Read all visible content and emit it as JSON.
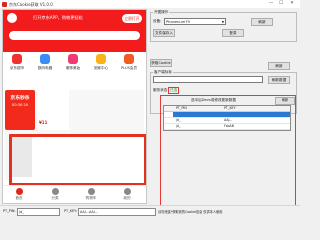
{
  "window": {
    "title": "京东Cookie获取 V1.0.0",
    "minimize": "—",
    "maximize": "☐",
    "close": "✕"
  },
  "phone": {
    "banner_text": "打开京东APP，购物更轻松",
    "open_button": "立即打开",
    "icons": [
      {
        "label": "京东超市",
        "color": "#f23030"
      },
      {
        "label": "数码电器",
        "color": "#3b8cf7"
      },
      {
        "label": "服饰美妆",
        "color": "#f23a72"
      },
      {
        "label": "到家中心",
        "color": "#f7b319"
      },
      {
        "label": "PLUS会员",
        "color": "#f25a22"
      }
    ],
    "promo": {
      "line1": "京东秒杀",
      "line2": "00:30:20"
    },
    "promo_price": "¥11",
    "nav": [
      {
        "label": "首页"
      },
      {
        "label": "分类"
      },
      {
        "label": "购物车"
      },
      {
        "label": "我的"
      }
    ]
  },
  "right": {
    "account_group": {
      "title": "开图操作",
      "phone_label": "设备:",
      "device_value": "Phonenum79",
      "refresh_btn": "刷新",
      "open_btn": "登录",
      "save_btn": "文件保存入"
    },
    "cookie_group": {
      "button": "获取Cookie",
      "ua_label": "客户端标标",
      "refresh_button": "刷新",
      "import_button": "刷新数据"
    },
    "table": {
      "status_label": "服务状态:",
      "status_value": "已连",
      "caption": "选中后Devs或修改更新数据",
      "refresh": "刷新",
      "columns": [
        "PT_PIN",
        "PT_KEY"
      ],
      "rows": [
        {
          "pin": "",
          "key": "",
          "selected": true
        },
        {
          "pin": "jd_",
          "key": "AAJ...",
          "selected": false
        },
        {
          "pin": "jd_",
          "key": "FsbAB",
          "selected": false
        }
      ]
    }
  },
  "status": {
    "pin_label": "PT_PIN:",
    "pin_value": "jd_",
    "key_label": "PT_KEY:",
    "key_value": "AAJ...AAJ...",
    "note": "请勿泄露*获取到的Cookie信息 仅供本人使用"
  }
}
